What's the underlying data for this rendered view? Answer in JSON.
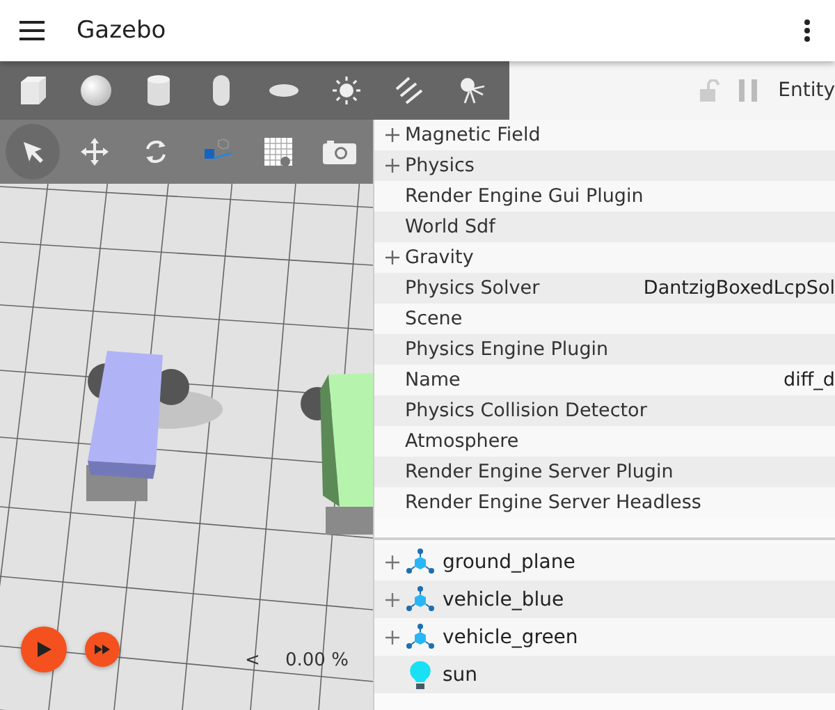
{
  "app_bar": {
    "title": "Gazebo"
  },
  "shapes": [
    {
      "kind": "box"
    },
    {
      "kind": "sphere"
    },
    {
      "kind": "cylinder"
    },
    {
      "kind": "capsule"
    },
    {
      "kind": "ellipsoid"
    },
    {
      "kind": "point_light"
    },
    {
      "kind": "directional_light"
    },
    {
      "kind": "spot_light"
    }
  ],
  "tools": [
    {
      "kind": "select",
      "selected": true
    },
    {
      "kind": "translate",
      "selected": false
    },
    {
      "kind": "rotate",
      "selected": false
    },
    {
      "kind": "transform",
      "selected": false
    },
    {
      "kind": "grid",
      "selected": false
    },
    {
      "kind": "screenshot",
      "selected": false
    }
  ],
  "playback": {
    "step_caret": "<",
    "real_time_factor": "0.00 %"
  },
  "panel_header": {
    "title": "Entity"
  },
  "properties": [
    {
      "label": "Magnetic Field",
      "expandable": true
    },
    {
      "label": "Physics",
      "expandable": true
    },
    {
      "label": "Render Engine Gui Plugin",
      "expandable": false
    },
    {
      "label": "World Sdf",
      "expandable": false
    },
    {
      "label": "Gravity",
      "expandable": true
    },
    {
      "label": "Physics Solver",
      "expandable": false,
      "value": "DantzigBoxedLcpSol"
    },
    {
      "label": "Scene",
      "expandable": false
    },
    {
      "label": "Physics Engine Plugin",
      "expandable": false
    },
    {
      "label": "Name",
      "expandable": false,
      "value": "diff_d"
    },
    {
      "label": "Physics Collision Detector",
      "expandable": false
    },
    {
      "label": "Atmosphere",
      "expandable": false
    },
    {
      "label": "Render Engine Server Plugin",
      "expandable": false
    },
    {
      "label": "Render Engine Server Headless",
      "expandable": false
    }
  ],
  "entities": [
    {
      "name": "ground_plane",
      "kind": "model",
      "expandable": true
    },
    {
      "name": "vehicle_blue",
      "kind": "model",
      "expandable": true
    },
    {
      "name": "vehicle_green",
      "kind": "model",
      "expandable": true
    },
    {
      "name": "sun",
      "kind": "light",
      "expandable": false
    }
  ]
}
